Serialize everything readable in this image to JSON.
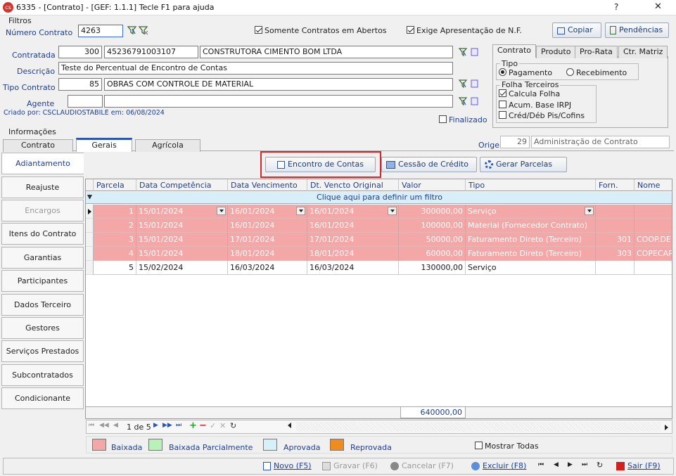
{
  "window": {
    "icon_text": "cs",
    "title": "6335 - [Contrato] - [GEF: 1.1.1]  Tecle F1 para ajuda",
    "help": "?",
    "close": "✕"
  },
  "filtros": {
    "legend": "Filtros",
    "numero_label": "Número Contrato",
    "numero_value": "4263",
    "somente_abertos": "Somente Contratos em Abertos",
    "exige_nf": "Exige Apresentação de N.F.",
    "copiar": "Copiar",
    "pendencias": "Pendências"
  },
  "form": {
    "contratada_label": "Contratada",
    "contratada_code": "300",
    "contratada_cnpj": "45236791003107",
    "contratada_name": "CONSTRUTORA CIMENTO BOM LTDA",
    "descricao_label": "Descrição",
    "descricao_value": "Teste do Percentual de Encontro de Contas",
    "tipo_label": "Tipo Contrato",
    "tipo_code": "85",
    "tipo_name": "OBRAS COM CONTROLE DE MATERIAL",
    "agente_label": "Agente",
    "agente_code": "",
    "agente_name": "",
    "criado": "Criado por: CSCLAUDIOSTABILE em: 06/08/2024",
    "finalizado": "Finalizado"
  },
  "right_tabs": [
    "Contrato",
    "Produto",
    "Pro-Rata",
    "Ctr. Matriz"
  ],
  "tipo_group": {
    "legend": "Tipo",
    "pagamento": "Pagamento",
    "recebimento": "Recebimento"
  },
  "folha_group": {
    "legend": "Folha Terceiros",
    "calcula": "Calcula Folha",
    "acum": "Acum. Base IRPJ",
    "cred": "Créd/Déb Pis/Cofins"
  },
  "info": {
    "legend": "Informações",
    "tabs": [
      "Contrato",
      "Gerais",
      "Agrícola"
    ],
    "origem_label": "Origem",
    "origem_code": "29",
    "origem_name": "Administração de Contrato"
  },
  "actions": {
    "encontro": "Encontro de Contas",
    "cessao": "Cessão de Crédito",
    "gerar": "Gerar Parcelas"
  },
  "sidebar": [
    "Adiantamento",
    "Reajuste",
    "Encargos",
    "Itens do Contrato",
    "Garantias",
    "Participantes",
    "Dados Terceiro",
    "Gestores",
    "Serviços Prestados",
    "Subcontratados",
    "Condicionante"
  ],
  "grid": {
    "headers": [
      "Parcela",
      "Data Competência",
      "Data Vencimento",
      "Dt. Vencto Original",
      "Valor",
      "Tipo",
      "Forn.",
      "Nome"
    ],
    "filter_text": "Clique aqui para definir um filtro",
    "rows": [
      [
        "1",
        "15/01/2024",
        "16/01/2024",
        "16/01/2024",
        "300000,00",
        "Serviço",
        "",
        ""
      ],
      [
        "2",
        "15/01/2024",
        "16/01/2024",
        "16/01/2024",
        "100000,00",
        "Material (Fornecedor Contrato)",
        "",
        ""
      ],
      [
        "3",
        "15/01/2024",
        "17/01/2024",
        "17/01/2024",
        "50000,00",
        "Faturamento Direto (Terceiro)",
        "301",
        "COOP.DE"
      ],
      [
        "4",
        "15/01/2024",
        "18/01/2024",
        "18/01/2024",
        "60000,00",
        "Faturamento Direto (Terceiro)",
        "303",
        "COPECAR"
      ],
      [
        "5",
        "15/02/2024",
        "16/03/2024",
        "16/03/2024",
        "130000,00",
        "Serviço",
        "",
        ""
      ]
    ],
    "total": "640000,00",
    "nav_text": "1 de 5"
  },
  "legend": {
    "baixada": "Baixada",
    "parcial": "Baixada Parcialmente",
    "aprovada": "Aprovada",
    "reprovada": "Reprovada",
    "mostrar": "Mostrar Todas",
    "colors": {
      "baixada": "#f4a7a7",
      "parcial": "#b9f2b9",
      "aprovada": "#d6f1f7",
      "reprovada": "#f08c1e"
    }
  },
  "footer": {
    "novo": "Novo (F5)",
    "gravar": "Gravar (F6)",
    "cancelar": "Cancelar (F7)",
    "excluir": "Excluir (F8)",
    "sair": "Sair (F9)"
  }
}
